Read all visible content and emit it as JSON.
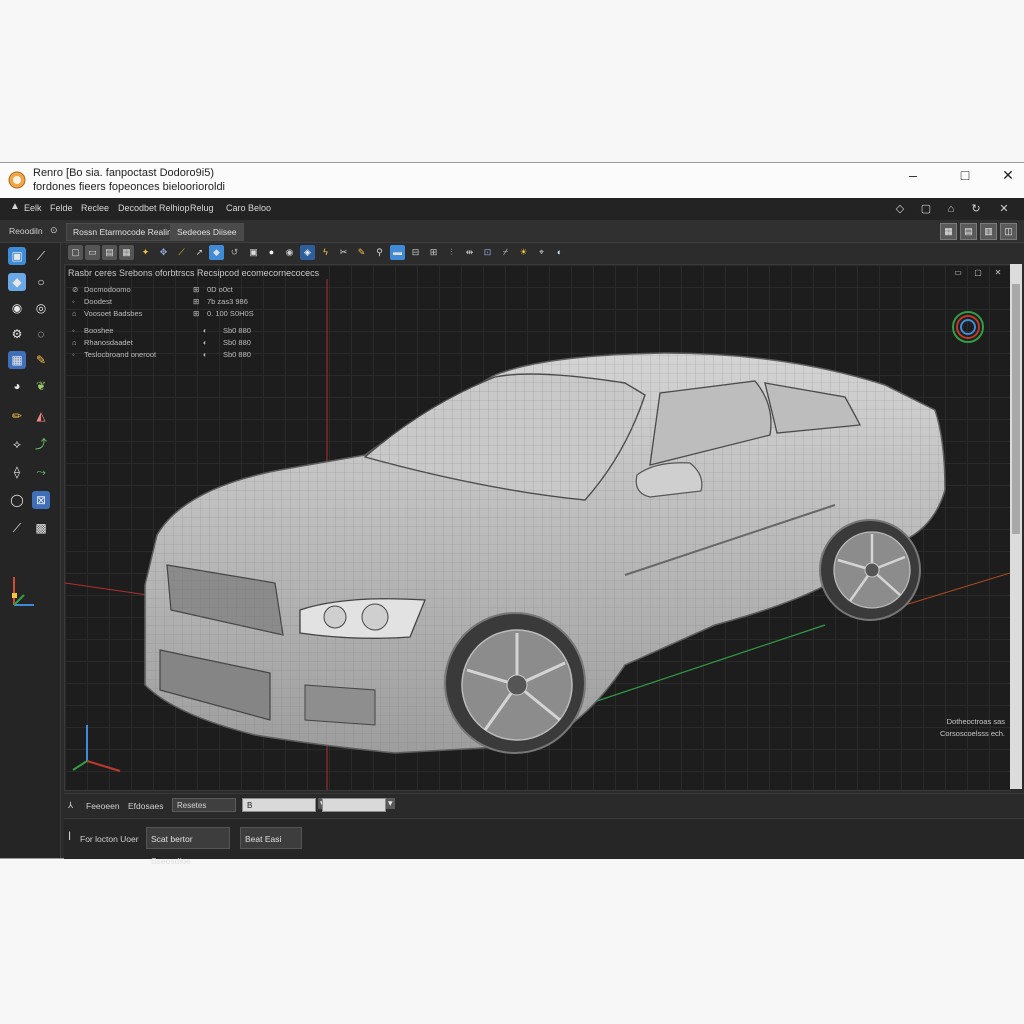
{
  "titlebar": {
    "line1": "Renro  [Bo sia.  fanpoctast  Dodoro9i5)",
    "line2": "fordones  fieers  fopeonces  bieloorioroldi",
    "minimize": "–",
    "maximize": "□",
    "close": "✕"
  },
  "menubar": {
    "items": [
      "Eelk",
      "Felde",
      "Reclee",
      "Decodbet Relhiop",
      "Relug",
      "Caro Beloo"
    ]
  },
  "toolbar": {
    "label": "Reoodiln",
    "tab1": "Rossn Etarmocode Realine",
    "tab2": "Sedeoes Diisee"
  },
  "viewport": {
    "header": "Rasbr ceres  Srebons oforbtrscs  Recsipcod ecomecornecocecs",
    "stats": [
      {
        "label": "Docmodoomo",
        "value": "0D  o0ct"
      },
      {
        "label": "Doodest",
        "value": "7b  zas3 986"
      },
      {
        "label": "Voosoet Badsbes",
        "value": "0.  100 S0H0S"
      },
      {
        "label": "Booshee",
        "value": "Sb0 880"
      },
      {
        "label": "Rhanosdaadet",
        "value": "Sb0 880"
      },
      {
        "label": "Teslocbroand oneroot",
        "value": "Sb0 880"
      }
    ],
    "corner": {
      "line1": "Dotheoctroas  sas",
      "line2": "Corsoscoelsss ech."
    }
  },
  "bottom": {
    "label1": "Feeoeen",
    "label2": "Efdosaes",
    "field1": "Resetes",
    "field2": "B",
    "field3": "",
    "label3": "For locton  Uoer",
    "btn1": "Scat bertor Sseosdioe",
    "btn2": "Beat Easi"
  },
  "colors": {
    "accent_blue": "#3f8bd8",
    "axis_red": "#c0392b",
    "axis_green": "#2f9e44"
  }
}
